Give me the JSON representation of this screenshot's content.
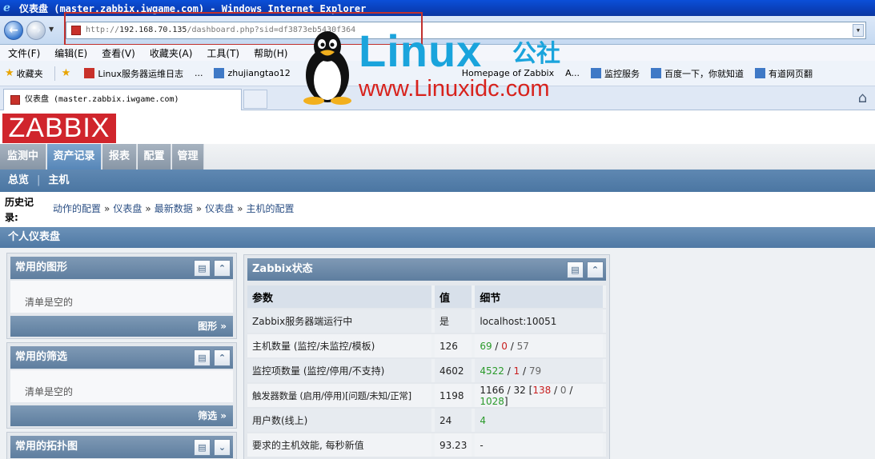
{
  "window": {
    "title": "仪表盘 (master.zabbix.iwgame.com) - Windows Internet Explorer"
  },
  "address": {
    "url_scheme": "http://",
    "url_host": "192.168.70.135",
    "url_path": "/dashboard.php?sid=df3873eb5430f364"
  },
  "menu": [
    "文件(F)",
    "编辑(E)",
    "查看(V)",
    "收藏夹(A)",
    "工具(T)",
    "帮助(H)"
  ],
  "favorites": {
    "label": "收藏夹",
    "items": [
      "Linux服务器运维日志",
      "...",
      "zhujiangtao12",
      "Homepage of Zabbix",
      "A...",
      "监控服务",
      "百度一下，你就知道",
      "有道网页翻"
    ]
  },
  "tab": {
    "title": "仪表盘 (master.zabbix.iwgame.com)"
  },
  "watermark": {
    "brand": "Linux",
    "suffix": "公社",
    "site": "www.Linuxidc.com"
  },
  "zabbix": {
    "logo": "ZABBIX",
    "topnav": [
      "监测中",
      "资产记录",
      "报表",
      "配置",
      "管理"
    ],
    "subnav": [
      "总览",
      "主机"
    ],
    "history_label": "历史记录:",
    "history": [
      "动作的配置",
      "仪表盘",
      "最新数据",
      "仪表盘",
      "主机的配置"
    ],
    "section_title": "个人仪表盘",
    "widgets": {
      "graphs": {
        "title": "常用的图形",
        "empty": "清单是空的",
        "link": "图形 »"
      },
      "filters": {
        "title": "常用的筛选",
        "empty": "清单是空的",
        "link": "筛选 »"
      },
      "maps": {
        "title": "常用的拓扑图"
      }
    },
    "status": {
      "title": "Zabbix状态",
      "headers": [
        "参数",
        "值",
        "细节"
      ],
      "rows": [
        {
          "param": "Zabbix服务器端运行中",
          "value": "是",
          "detail": "localhost:10051"
        },
        {
          "param": "主机数量 (监控/未监控/模板)",
          "value": "126",
          "d1": "69",
          "d2": "0",
          "d3": "57"
        },
        {
          "param": "监控项数量 (监控/停用/不支持)",
          "value": "4602",
          "d1": "4522",
          "d2": "1",
          "d3": "79"
        },
        {
          "param": "触发器数量 (启用/停用)[问题/未知/正常]",
          "value": "1198",
          "d0": "1166 / 32",
          "d1": "138",
          "d2": "0",
          "d3": "1028"
        },
        {
          "param": "用户数(线上)",
          "value": "24",
          "d1": "4"
        },
        {
          "param": "要求的主机效能, 每秒新值",
          "value": "93.23",
          "detail": "-"
        }
      ]
    }
  }
}
